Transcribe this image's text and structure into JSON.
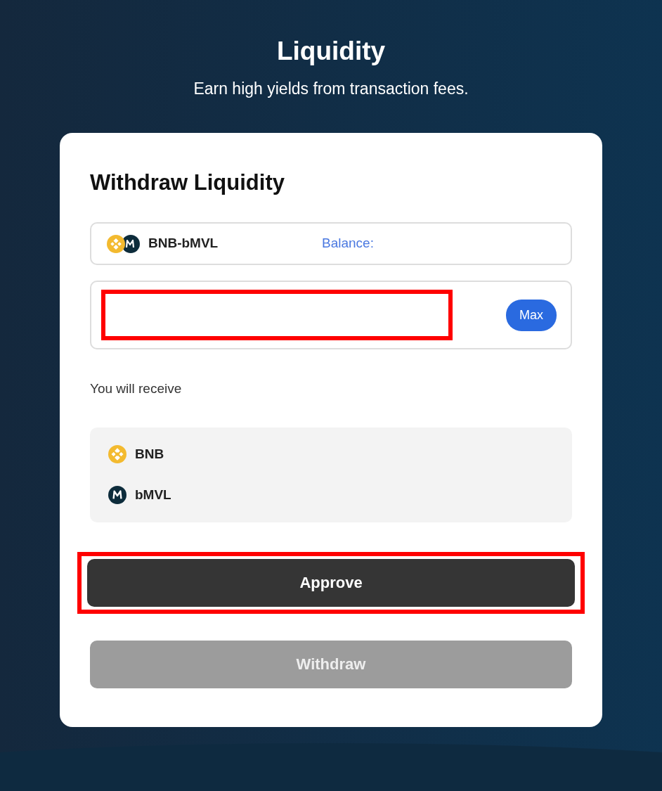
{
  "header": {
    "title": "Liquidity",
    "subtitle": "Earn high yields from transaction fees."
  },
  "card": {
    "title": "Withdraw Liquidity",
    "pair": {
      "label": "BNB-bMVL",
      "balance_label": "Balance:"
    },
    "amount": {
      "highlighted": true,
      "max_button": "Max"
    },
    "receive_label": "You will receive",
    "receive_tokens": [
      {
        "kind": "bnb",
        "label": "BNB"
      },
      {
        "kind": "mvl",
        "label": "bMVL"
      }
    ],
    "buttons": [
      {
        "label": "Approve",
        "disabled": false,
        "highlighted": true
      },
      {
        "label": "Withdraw",
        "disabled": true,
        "highlighted": false
      }
    ]
  }
}
